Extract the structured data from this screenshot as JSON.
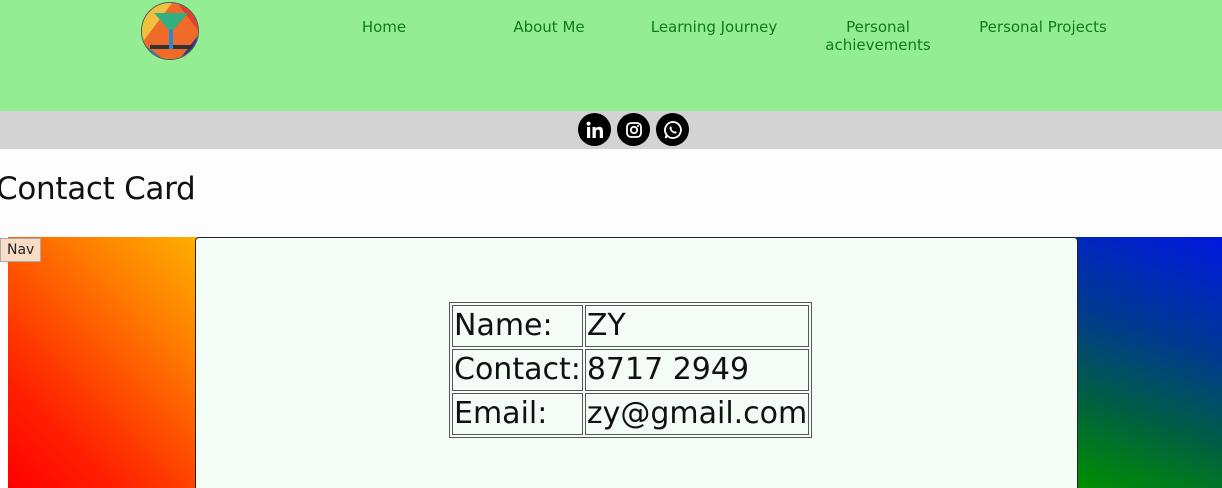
{
  "header": {
    "logo_icon": "logo-icon",
    "nav": [
      {
        "label": "Home"
      },
      {
        "label": "About Me"
      },
      {
        "label": "Learning Journey"
      },
      {
        "label": "Personal achievements"
      },
      {
        "label": "Personal Projects"
      }
    ],
    "nav_color": "#0f7a1a",
    "background": "#93ee93"
  },
  "social": {
    "icons": [
      "linkedin-icon",
      "instagram-icon",
      "whatsapp-icon"
    ],
    "background": "#d3d3d3"
  },
  "page": {
    "title": "Contact Card",
    "nav_button": "Nav"
  },
  "contact": {
    "rows": [
      {
        "label": "Name:",
        "value": "ZY"
      },
      {
        "label": "Contact:",
        "value": "8717 2949"
      },
      {
        "label": "Email:",
        "value": "zy@gmail.com"
      }
    ]
  }
}
